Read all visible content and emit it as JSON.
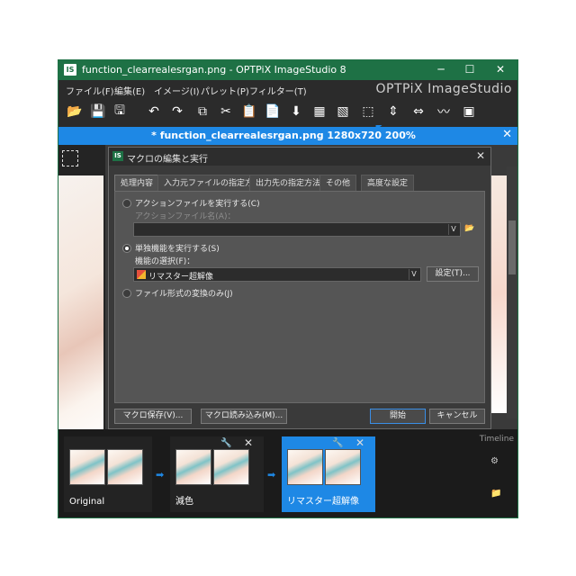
{
  "window": {
    "title": "function_clearrealesrgan.png - OPTPiX ImageStudio 8",
    "app_icon": "IS",
    "minimize_symbol": "─",
    "maximize_symbol": "☐",
    "close_symbol": "✕"
  },
  "menu": {
    "items": [
      "ファイル(F)",
      "編集(E)",
      "イメージ(I)",
      "パレット(P)",
      "フィルター(T)"
    ],
    "brand": "OPTPiX ImageStudio"
  },
  "toolbar": {
    "icons": [
      "open-folder-icon",
      "save-icon",
      "save-as-icon",
      "undo-icon",
      "redo-icon",
      "copy-icon",
      "cut-icon",
      "paste-icon",
      "paste-new-icon",
      "import-icon",
      "palette-icon",
      "filter-icon",
      "resize-icon",
      "flip-vertical-icon",
      "flip-horizontal-icon",
      "curve-icon",
      "channel-icon"
    ],
    "glyphs": [
      "📂",
      "💾",
      "🖫",
      "↶",
      "↷",
      "⧉",
      "✂",
      "📋",
      "📄",
      "⬇",
      "▦",
      "▧",
      "⬚",
      "⇕",
      "⇔",
      "〰",
      "▣"
    ]
  },
  "document": {
    "title": "* function_clearrealesrgan.png 1280x720 200%",
    "close_symbol": "✕"
  },
  "dialog": {
    "icon": "IS",
    "title": "マクロの編集と実行",
    "close_symbol": "✕",
    "tabs": [
      "処理内容",
      "入力元ファイルの指定方法",
      "出力先の指定方法",
      "その他",
      "高度な設定"
    ],
    "options": {
      "action_file_label": "アクションファイルを実行する(C)",
      "action_file_name_label": "アクションファイル名(A)：",
      "action_file_value": "",
      "single_function_label": "単独機能を実行する(S)",
      "function_select_label": "機能の選択(F)：",
      "function_value": "リマスター超解像",
      "settings_button": "設定(T)...",
      "convert_only_label": "ファイル形式の変換のみ(J)"
    },
    "buttons": {
      "save_macro": "マクロ保存(V)...",
      "load_macro": "マクロ読み込み(M)...",
      "start": "開始",
      "cancel": "キャンセル"
    }
  },
  "timeline": {
    "label": "Timeline",
    "nodes": [
      {
        "label": "Original"
      },
      {
        "label": "減色"
      },
      {
        "label": "リマスター超解像"
      }
    ]
  }
}
